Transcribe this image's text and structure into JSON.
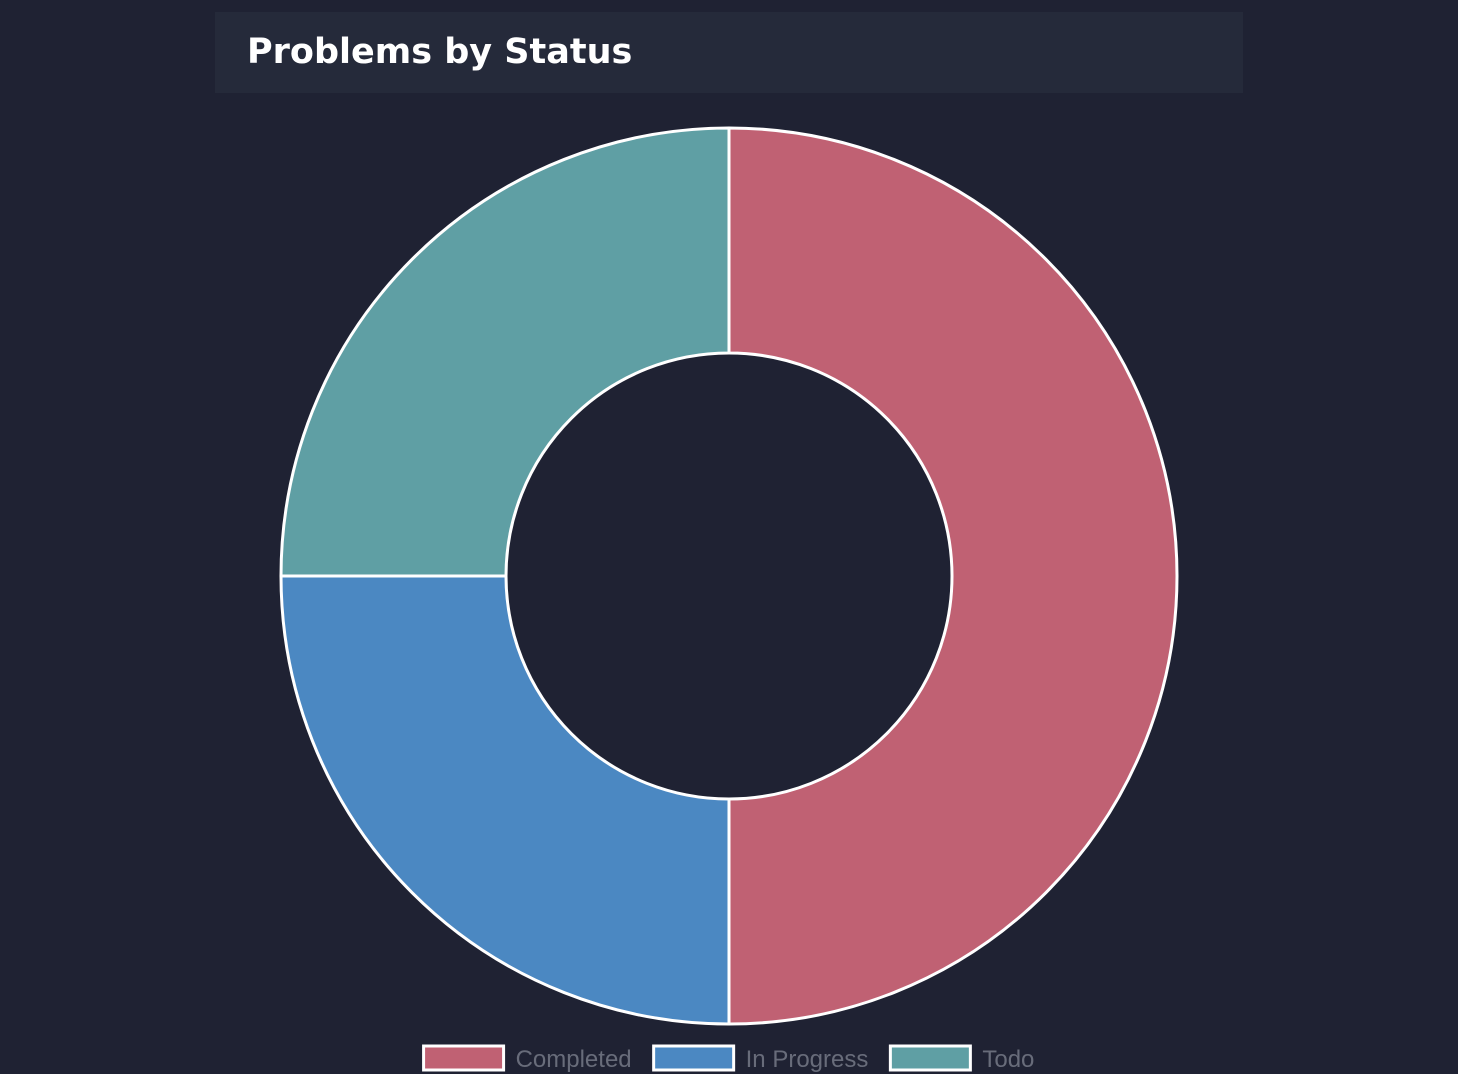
{
  "card": {
    "title": "Problems by Status"
  },
  "colors": {
    "page_background": "#1f2233",
    "header_background": "#252a3a",
    "slice_border": "#ffffff",
    "legend_text": "#686c7a"
  },
  "chart_data": {
    "type": "doughnut",
    "title": "Problems by Status",
    "categories": [
      "Completed",
      "In Progress",
      "Todo"
    ],
    "values": [
      2,
      1,
      1
    ],
    "colors": [
      "#c06173",
      "#4b88c2",
      "#5f9fa4"
    ],
    "legend": "bottom"
  }
}
